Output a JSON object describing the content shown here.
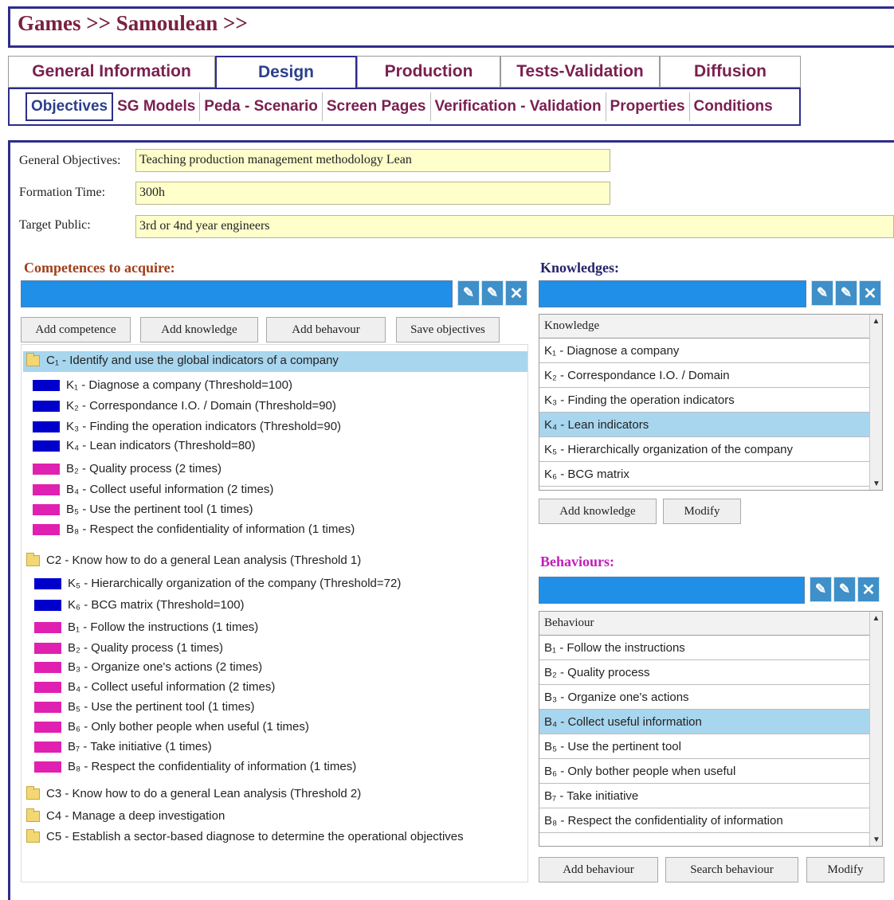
{
  "breadcrumb": "Games >> Samoulean >>",
  "tabs": [
    "General Information",
    "Design",
    "Production",
    "Tests-Validation",
    "Diffusion"
  ],
  "subtabs": [
    "Objectives",
    "SG Models",
    "Peda - Scenario",
    "Screen Pages",
    "Verification - Validation",
    "Properties",
    "Conditions"
  ],
  "form": {
    "general_objectives_label": "General Objectives:",
    "general_objectives_value": "Teaching production management methodology Lean",
    "formation_time_label": "Formation Time:",
    "formation_time_value": "300h",
    "target_public_label": "Target Public:",
    "target_public_value": "3rd or 4nd year engineers"
  },
  "competences": {
    "title": "Competences to acquire:",
    "buttons": [
      "Add competence",
      "Add knowledge",
      "Add behavour",
      "Save objectives"
    ],
    "tree": [
      {
        "type": "folder",
        "label": "C₁ - Identify and use the global indicators of a company"
      },
      {
        "type": "k",
        "label": "K₁ - Diagnose a company (Threshold=100)"
      },
      {
        "type": "k",
        "label": "K₂ - Correspondance I.O. / Domain (Threshold=90)"
      },
      {
        "type": "k",
        "label": "K₃ - Finding the operation indicators (Threshold=90)"
      },
      {
        "type": "k",
        "label": "K₄ - Lean indicators (Threshold=80)"
      },
      {
        "type": "b",
        "label": "B₂ - Quality process (2 times)"
      },
      {
        "type": "b",
        "label": "B₄ - Collect useful information (2 times)"
      },
      {
        "type": "b",
        "label": "B₅ - Use the pertinent tool (1 times)"
      },
      {
        "type": "b",
        "label": "B₈ - Respect the confidentiality of information (1 times)"
      },
      {
        "type": "folder",
        "label": "C2 - Know how to do a general Lean analysis (Threshold 1)"
      },
      {
        "type": "k",
        "label": "K₅ - Hierarchically organization of the company (Threshold=72)"
      },
      {
        "type": "k",
        "label": "K₆ - BCG matrix (Threshold=100)"
      },
      {
        "type": "b",
        "label": "B₁ - Follow the instructions (1 times)"
      },
      {
        "type": "b",
        "label": "B₂ - Quality process (1 times)"
      },
      {
        "type": "b",
        "label": "B₃ - Organize one's actions (2 times)"
      },
      {
        "type": "b",
        "label": "B₄ - Collect useful information (2 times)"
      },
      {
        "type": "b",
        "label": "B₅ - Use the pertinent tool (1 times)"
      },
      {
        "type": "b",
        "label": "B₆ - Only bother people when useful (1 times)"
      },
      {
        "type": "b",
        "label": "B₇ - Take initiative (1 times)"
      },
      {
        "type": "b",
        "label": "B₈ - Respect the confidentiality of information (1 times)"
      },
      {
        "type": "folder",
        "label": "C3 - Know how to do a general Lean analysis (Threshold 2)"
      },
      {
        "type": "folder",
        "label": "C4 - Manage a deep investigation"
      },
      {
        "type": "folder",
        "label": "C5 - Establish a sector-based diagnose to determine the operational objectives"
      }
    ]
  },
  "knowledges": {
    "title": "Knowledges:",
    "header": "Knowledge",
    "items": [
      "K₁ - Diagnose a company",
      "K₂ - Correspondance I.O. / Domain",
      "K₃ - Finding the operation indicators",
      "K₄ - Lean indicators",
      "K₅ - Hierarchically organization of the company",
      "K₆ - BCG matrix"
    ],
    "selected_index": 3,
    "buttons": [
      "Add knowledge",
      "Modify"
    ]
  },
  "behaviours": {
    "title": "Behaviours:",
    "header": "Behaviour",
    "items": [
      "B₁ - Follow the instructions",
      "B₂ - Quality process",
      "B₃ - Organize one's actions",
      "B₄ - Collect useful information",
      "B₅ - Use the pertinent tool",
      "B₆ - Only bother people when useful",
      "B₇ - Take initiative",
      "B₈ - Respect the confidentiality of information"
    ],
    "selected_index": 3,
    "buttons": [
      "Add behaviour",
      "Search behaviour",
      "Modify"
    ]
  },
  "colors": {
    "knowledge_swatch": "#0000cc",
    "behaviour_swatch": "#e020b0",
    "competences_title": "#a0401c",
    "knowledges_title": "#24246a",
    "behaviours_title": "#c020b8",
    "search_bar": "#1f8fe8",
    "selection": "#a8d6ee"
  },
  "icons": [
    "edit-icon",
    "edit-icon",
    "delete-icon"
  ]
}
